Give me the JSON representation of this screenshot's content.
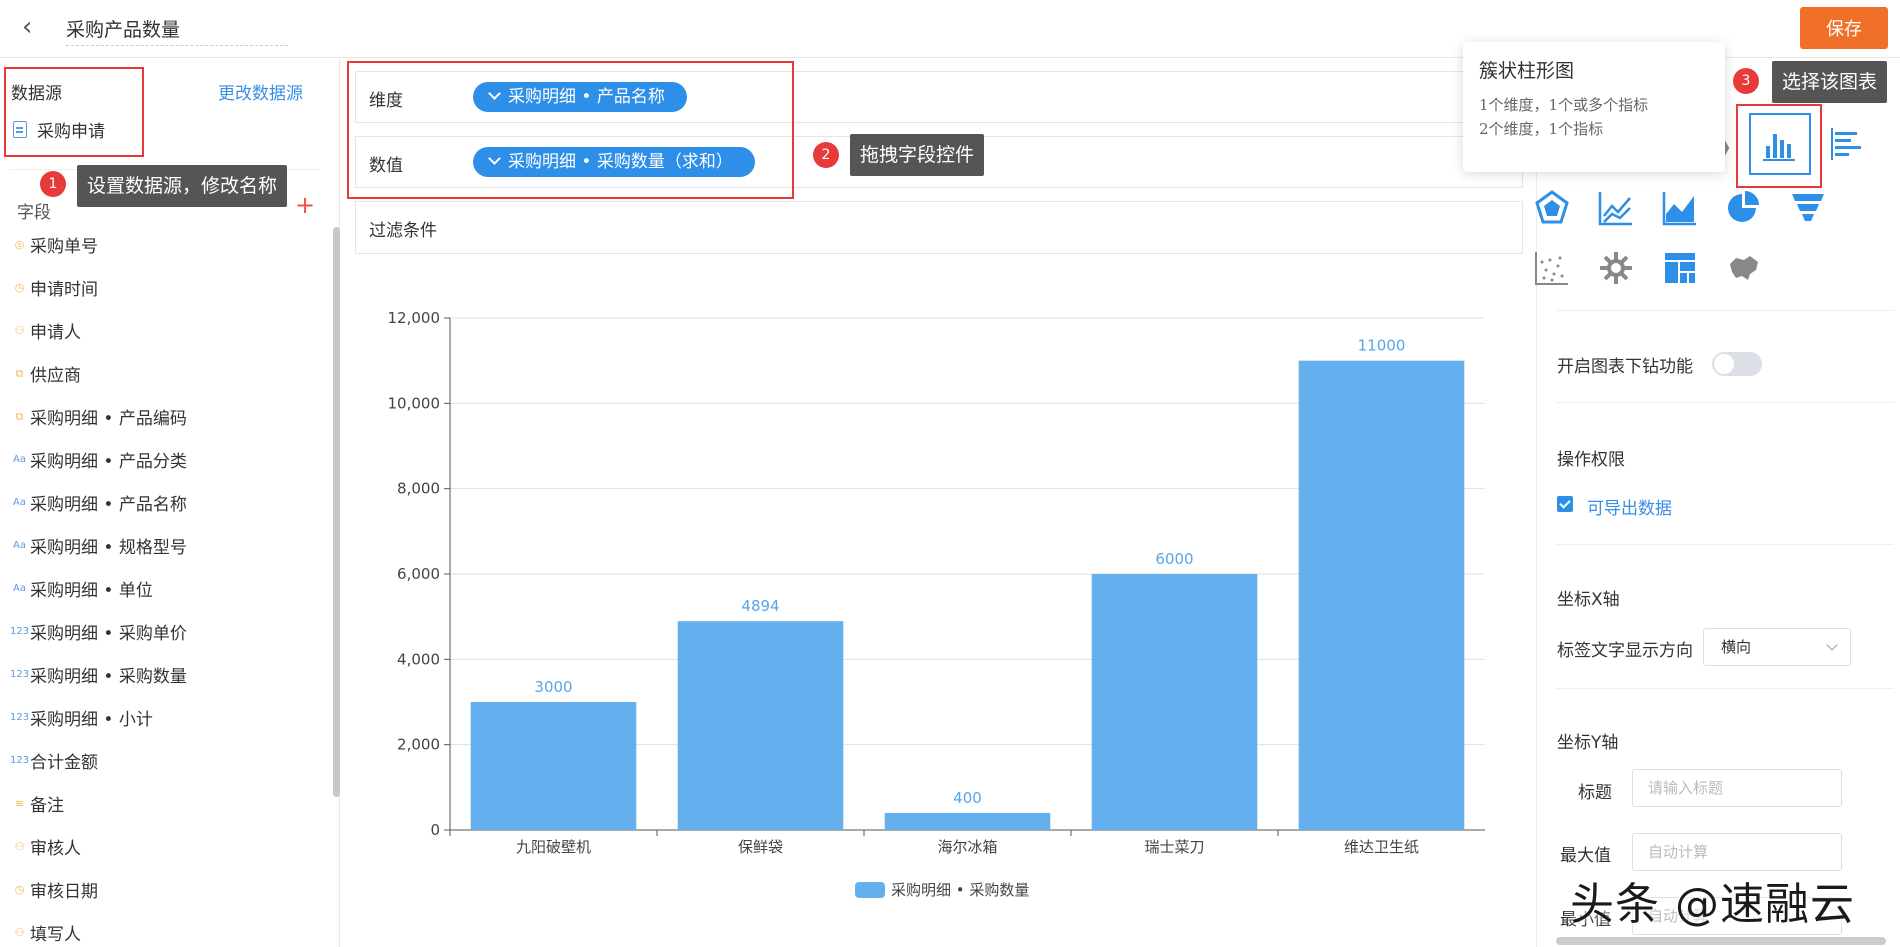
{
  "header": {
    "title": "采购产品数量",
    "save_label": "保存"
  },
  "sidebar": {
    "datasource_label": "数据源",
    "change_datasource": "更改数据源",
    "datasource_name": "采购申请",
    "fields_label": "字段",
    "fields": [
      {
        "label": "采购单号",
        "icon": "serial"
      },
      {
        "label": "申请时间",
        "icon": "clock"
      },
      {
        "label": "申请人",
        "icon": "user"
      },
      {
        "label": "供应商",
        "icon": "relation"
      },
      {
        "label": "采购明细 • 产品编码",
        "icon": "relation"
      },
      {
        "label": "采购明细 • 产品分类",
        "icon": "text"
      },
      {
        "label": "采购明细 • 产品名称",
        "icon": "text"
      },
      {
        "label": "采购明细 • 规格型号",
        "icon": "text"
      },
      {
        "label": "采购明细 • 单位",
        "icon": "text"
      },
      {
        "label": "采购明细 • 采购单价",
        "icon": "number"
      },
      {
        "label": "采购明细 • 采购数量",
        "icon": "number"
      },
      {
        "label": "采购明细 • 小计",
        "icon": "number"
      },
      {
        "label": "合计金额",
        "icon": "number"
      },
      {
        "label": "备注",
        "icon": "textarea"
      },
      {
        "label": "审核人",
        "icon": "user"
      },
      {
        "label": "审核日期",
        "icon": "clock"
      },
      {
        "label": "填写人",
        "icon": "user"
      }
    ]
  },
  "annotations": {
    "a1": {
      "num": "1",
      "text": "设置数据源，修改名称"
    },
    "a2": {
      "num": "2",
      "text": "拖拽字段控件"
    },
    "a3": {
      "num": "3",
      "text": "选择该图表"
    }
  },
  "config": {
    "dimension_label": "维度",
    "dimension_value": "采购明细 • 产品名称",
    "measure_label": "数值",
    "measure_value": "采购明细 • 采购数量（求和）",
    "filter_label": "过滤条件"
  },
  "chart_data": {
    "type": "bar",
    "categories": [
      "九阳破壁机",
      "保鲜袋",
      "海尔冰箱",
      "瑞士菜刀",
      "维达卫生纸"
    ],
    "series": [
      {
        "name": "采购明细 • 采购数量",
        "values": [
          3000,
          4894,
          400,
          6000,
          11000
        ]
      }
    ],
    "yticks": [
      "0",
      "2,000",
      "4,000",
      "6,000",
      "8,000",
      "10,000",
      "12,000"
    ],
    "ylim": [
      0,
      12000
    ],
    "bar_color": "#64b0ee",
    "label_color": "#5aa5e6",
    "legend": "bottom-center",
    "grid": true
  },
  "popup": {
    "title": "簇状柱形图",
    "line1": "1个维度，1个或多个指标",
    "line2": "2个维度，1个指标"
  },
  "right_panel": {
    "drill_label": "开启图表下钻功能",
    "permission_label": "操作权限",
    "export_label": "可导出数据",
    "xaxis_label": "坐标X轴",
    "label_dir_label": "标签文字显示方向",
    "label_dir_value": "横向",
    "yaxis_label": "坐标Y轴",
    "title_label": "标题",
    "title_placeholder": "请输入标题",
    "max_label": "最大值",
    "max_placeholder": "自动计算",
    "min_label": "最小值",
    "min_placeholder": "自动计算"
  },
  "watermark": "头条 @速融云",
  "colors": {
    "accent": "#2d8fe8",
    "save": "#f0702a",
    "annotation": "#e93a3a"
  }
}
